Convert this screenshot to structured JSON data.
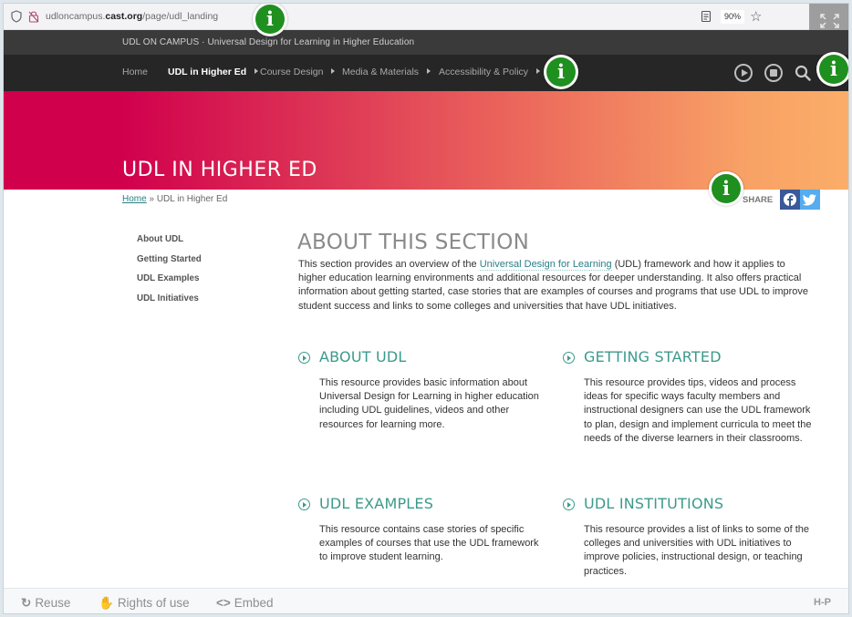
{
  "browser": {
    "url_prefix": "udloncampus.",
    "url_domain": "cast.org",
    "url_path": "/page/udl_landing",
    "zoom_level": "90%"
  },
  "site": {
    "top_title": "UDL ON CAMPUS · Universal Design for Learning in Higher Education",
    "nav": [
      {
        "label": "Home",
        "active": false,
        "submenu": false
      },
      {
        "label": "UDL in Higher Ed",
        "active": true,
        "submenu": true
      },
      {
        "label": "Course Design",
        "active": false,
        "submenu": true
      },
      {
        "label": "Media & Materials",
        "active": false,
        "submenu": true
      },
      {
        "label": "Accessibility & Policy",
        "active": false,
        "submenu": true
      }
    ],
    "controls": [
      "play-icon",
      "stop-icon",
      "search-icon"
    ]
  },
  "banner": {
    "title": "UDL IN HIGHER ED",
    "gradient_start": "#d1004d",
    "gradient_end": "#fbad68"
  },
  "breadcrumb": {
    "home": "Home",
    "separator": "»",
    "current": "UDL in Higher Ed"
  },
  "share": {
    "label": "SHARE",
    "networks": [
      "facebook",
      "twitter"
    ]
  },
  "sidebar": {
    "items": [
      "About UDL",
      "Getting Started",
      "UDL Examples",
      "UDL Initiatives"
    ]
  },
  "main": {
    "heading": "ABOUT THIS SECTION",
    "intro_before": "This section provides an overview of the ",
    "intro_link": "Universal Design for Learning",
    "intro_after": " (UDL) framework and how it applies to higher education learning environments and additional resources for deeper understanding. It also offers practical information about getting started, case stories that are examples of courses and programs that use UDL to improve student success and links to some colleges and universities that have UDL initiatives.",
    "cards": [
      {
        "title": "ABOUT UDL",
        "desc": "This resource provides basic information about Universal Design for Learning in higher education including UDL guidelines, videos and other resources for learning more."
      },
      {
        "title": "GETTING STARTED",
        "desc": "This resource provides tips, videos and process ideas for specific ways faculty members and instructional designers can use the UDL framework to plan, design and implement curricula to meet the needs of the diverse learners in their classrooms."
      },
      {
        "title": "UDL EXAMPLES",
        "desc": "This resource contains case stories of specific examples of courses that use the UDL framework to improve student learning."
      },
      {
        "title": "UDL INSTITUTIONS",
        "desc": "This resource provides a list of links to some of the colleges and universities with UDL initiatives to improve policies, instructional design, or teaching practices."
      }
    ],
    "accent_color": "#3b9a8c"
  },
  "hotspots": {
    "glyph": "i",
    "count": 4
  },
  "footer": {
    "reuse": "Reuse",
    "rights": "Rights of use",
    "embed": "Embed",
    "embed_icon": "<>",
    "brand": "H-P"
  }
}
